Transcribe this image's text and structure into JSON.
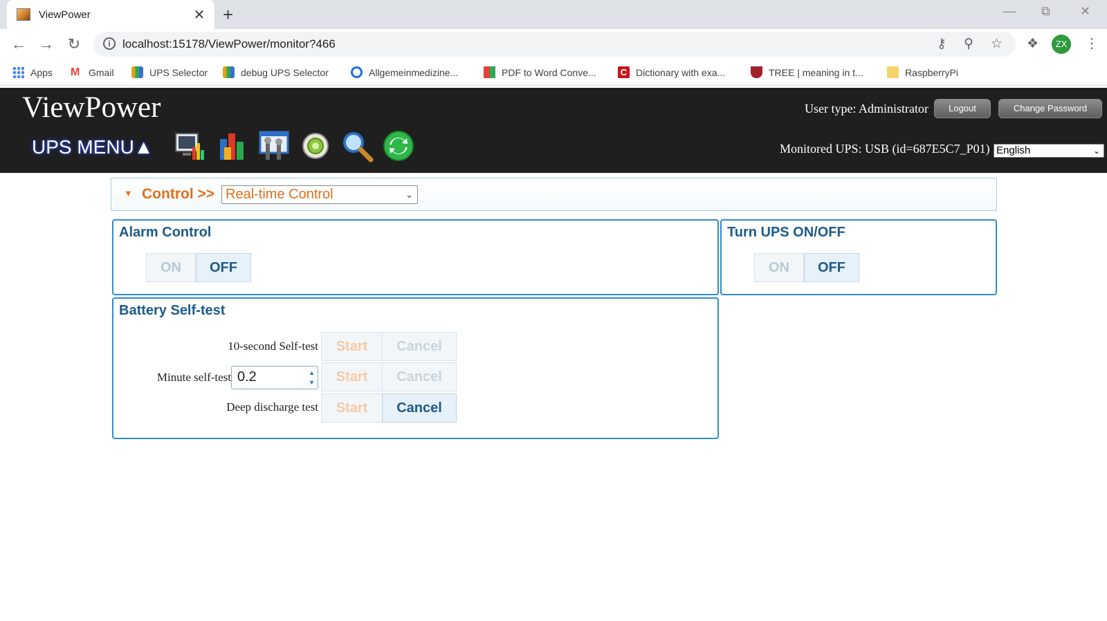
{
  "browser": {
    "tab_title": "ViewPower",
    "tab_close": "✕",
    "new_tab": "+",
    "url": "localhost:15178/ViewPower/monitor?466",
    "avatar": "ZX",
    "bookmarks": [
      {
        "label": "Apps",
        "icon": "apps-grid-icon",
        "color": "#4285f4"
      },
      {
        "label": "Gmail",
        "icon": "gmail-icon",
        "color": "#ea4335"
      },
      {
        "label": "UPS Selector",
        "icon": "ups-selector-icon",
        "color": "#e0a21a"
      },
      {
        "label": "debug UPS Selector",
        "icon": "ups-selector-icon",
        "color": "#e0a21a"
      },
      {
        "label": "Allgemeinmedizine...",
        "icon": "allgemein-icon",
        "color": "#1a6fd6"
      },
      {
        "label": "PDF to Word Conve...",
        "icon": "pdf-word-icon",
        "color": "#f2a900"
      },
      {
        "label": "Dictionary with exa...",
        "icon": "dictionary-icon",
        "color": "#c4161c"
      },
      {
        "label": "TREE | meaning in t...",
        "icon": "cambridge-icon",
        "color": "#a3212a"
      },
      {
        "label": "RaspberryPi",
        "icon": "folder-icon",
        "color": "#f6d46b"
      }
    ]
  },
  "header": {
    "brand": "ViewPower",
    "user_type": "User type: Administrator",
    "logout": "Logout",
    "change_password": "Change Password",
    "ups_menu": "UPS MENU▲",
    "monitored": "Monitored UPS: USB (id=687E5C7_P01)",
    "language": "English",
    "toolbar_icons": [
      "monitor-icon",
      "history-icon",
      "settings-icon",
      "control-icon",
      "search-icon",
      "refresh-icon"
    ]
  },
  "breadcrumb": {
    "section": "Control >>",
    "page": "Real-time Control"
  },
  "alarm_control": {
    "title": "Alarm Control",
    "on": "ON",
    "off": "OFF"
  },
  "ups_onoff": {
    "title": "Turn UPS ON/OFF",
    "on": "ON",
    "off": "OFF"
  },
  "self_test": {
    "title": "Battery Self-test",
    "rows": [
      {
        "label": "10-second Self-test",
        "start": "Start",
        "cancel": "Cancel"
      },
      {
        "label": "Minute self-test",
        "value": "0.2",
        "start": "Start",
        "cancel": "Cancel"
      },
      {
        "label": "Deep discharge test",
        "start": "Start",
        "cancel": "Cancel"
      }
    ]
  }
}
